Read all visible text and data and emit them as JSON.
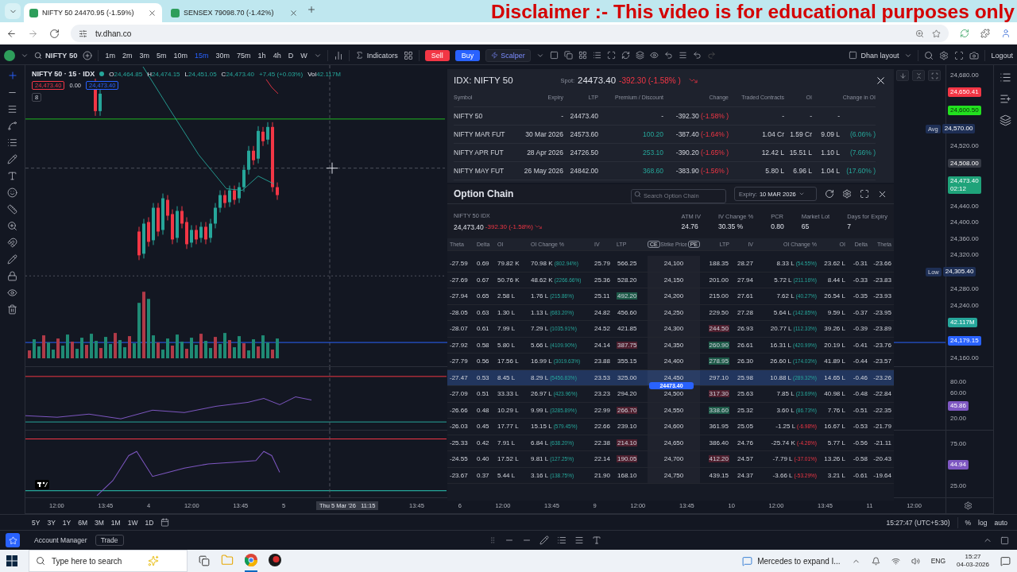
{
  "overlay_caption": "Disclaimer :- This video is for educational purposes only",
  "browser": {
    "tabs": [
      {
        "title": "NIFTY 50 24470.95 (-1.59%)",
        "selected": true
      },
      {
        "title": "SENSEX 79098.70 (-1.42%)",
        "selected": false
      }
    ],
    "url": "tv.dhan.co"
  },
  "toolbar": {
    "symbol": "NIFTY 50",
    "timeframes": [
      {
        "label": "1m",
        "selected": false
      },
      {
        "label": "2m",
        "selected": false
      },
      {
        "label": "3m",
        "selected": false
      },
      {
        "label": "5m",
        "selected": false
      },
      {
        "label": "10m",
        "selected": false
      },
      {
        "label": "15m",
        "selected": true
      },
      {
        "label": "30m",
        "selected": false
      },
      {
        "label": "75m",
        "selected": false
      },
      {
        "label": "1h",
        "selected": false
      },
      {
        "label": "4h",
        "selected": false
      },
      {
        "label": "D",
        "selected": false
      },
      {
        "label": "W",
        "selected": false
      }
    ],
    "indicators": "Indicators",
    "sell": "Sell",
    "buy": "Buy",
    "scalper": "Scalper",
    "layout": "Dhan layout",
    "logout": "Logout"
  },
  "chart": {
    "legend": {
      "title": "NIFTY 50 · 15 · IDX",
      "ohlc": [
        {
          "label": "O",
          "value": "24,464.85"
        },
        {
          "label": "H",
          "value": "24,474.15"
        },
        {
          "label": "L",
          "value": "24,451.05"
        },
        {
          "label": "C",
          "value": "24,473.40"
        }
      ],
      "change": "+7.45 (+0.03%)",
      "volume_label": "Vol",
      "volume": "42.117M"
    },
    "price_tags": [
      "24,473.40",
      "0.00",
      "24,473.40"
    ],
    "count": "8",
    "price_axis": [
      {
        "kind": "tick",
        "text": "24,680.00"
      },
      {
        "kind": "badge",
        "text": "24,650.41",
        "color": "#f23645"
      },
      {
        "kind": "badge",
        "text": "24,600.50",
        "color": "#22e01f"
      },
      {
        "kind": "badge",
        "text": "24,570.00",
        "color": "#1e2f55",
        "tag": "Avg"
      },
      {
        "kind": "tick",
        "text": "24,520.00"
      },
      {
        "kind": "badge",
        "text": "24,508.00",
        "color": "#363a45"
      },
      {
        "kind": "badge",
        "text": "24,473.40",
        "color": "#1fa37a",
        "sub": "02:12"
      },
      {
        "kind": "tick",
        "text": "24,440.00"
      },
      {
        "kind": "tick",
        "text": "24,400.00"
      },
      {
        "kind": "tick",
        "text": "24,360.00"
      },
      {
        "kind": "tick",
        "text": "24,320.00"
      },
      {
        "kind": "badge",
        "text": "24,305.40",
        "color": "#1e2f55",
        "tag": "Low"
      },
      {
        "kind": "tick",
        "text": "24,280.00"
      },
      {
        "kind": "tick",
        "text": "24,240.00"
      },
      {
        "kind": "badge",
        "text": "42.117M",
        "color": "#26a69a"
      },
      {
        "kind": "badge",
        "text": "24,179.15",
        "color": "#2962ff"
      },
      {
        "kind": "tick",
        "text": "24,160.00"
      }
    ],
    "pane2_axis": [
      {
        "kind": "tick",
        "text": "80.00"
      },
      {
        "kind": "tick",
        "text": "60.00"
      },
      {
        "kind": "badge",
        "text": "45.86",
        "color": "#7e57c2"
      },
      {
        "kind": "tick",
        "text": "20.00"
      }
    ],
    "pane3_axis": [
      {
        "kind": "tick",
        "text": "75.00"
      },
      {
        "kind": "badge",
        "text": "44.94",
        "color": "#7e57c2"
      },
      {
        "kind": "tick",
        "text": "25.00"
      }
    ],
    "time_axis": [
      {
        "kind": "tick",
        "text": "12:00"
      },
      {
        "kind": "tick",
        "text": "13:45"
      },
      {
        "kind": "tick",
        "text": "4"
      },
      {
        "kind": "tick",
        "text": "12:00"
      },
      {
        "kind": "tick",
        "text": "13:45"
      },
      {
        "kind": "tick",
        "text": "5"
      },
      {
        "kind": "cursor",
        "text": "Thu 5 Mar '26   11:15"
      },
      {
        "kind": "tick",
        "text": "13:45"
      },
      {
        "kind": "tick",
        "text": "6"
      },
      {
        "kind": "tick",
        "text": "12:00"
      },
      {
        "kind": "tick",
        "text": "13:45"
      },
      {
        "kind": "tick",
        "text": "9"
      },
      {
        "kind": "tick",
        "text": "12:00"
      },
      {
        "kind": "tick",
        "text": "13:45"
      },
      {
        "kind": "tick",
        "text": "10"
      },
      {
        "kind": "tick",
        "text": "12:00"
      },
      {
        "kind": "tick",
        "text": "13:45"
      },
      {
        "kind": "tick",
        "text": "11"
      },
      {
        "kind": "tick",
        "text": "12:00"
      }
    ]
  },
  "futures_panel": {
    "title": "IDX: NIFTY 50",
    "spot_label": "Spot:",
    "spot": "24473.40",
    "spot_change": "-392.30 (-1.58% )",
    "columns": [
      "Symbol",
      "Expiry",
      "LTP",
      "Premium / Discount",
      "Change",
      "Traded Contracts",
      "OI",
      "Change in OI"
    ],
    "rows": [
      {
        "symbol": "NIFTY 50",
        "expiry": "-",
        "ltp": "24473.40",
        "premium": "-",
        "change": "-392.30",
        "change_pct": "(-1.58% )",
        "traded": "-",
        "oi": "-",
        "oi_change": "-"
      },
      {
        "symbol": "NIFTY MAR FUT",
        "expiry": "30 Mar 2026",
        "ltp": "24573.60",
        "premium": "100.20",
        "change": "-387.40",
        "change_pct": "(-1.64% )",
        "traded": "1.04 Cr",
        "oi": "1.59 Cr",
        "oi_change": "9.09 L",
        "oi_change_pct": "(6.06% )"
      },
      {
        "symbol": "NIFTY APR FUT",
        "expiry": "28 Apr 2026",
        "ltp": "24726.50",
        "premium": "253.10",
        "change": "-390.20",
        "change_pct": "(-1.65% )",
        "traded": "12.42 L",
        "oi": "15.51 L",
        "oi_change": "1.10 L",
        "oi_change_pct": "(7.66% )"
      },
      {
        "symbol": "NIFTY MAY FUT",
        "expiry": "26 May 2026",
        "ltp": "24842.00",
        "premium": "368.60",
        "change": "-383.90",
        "change_pct": "(-1.56% )",
        "traded": "5.80 L",
        "oi": "6.96 L",
        "oi_change": "1.04 L",
        "oi_change_pct": "(17.60% )"
      }
    ]
  },
  "option_chain": {
    "title": "Option Chain",
    "search_placeholder": "Search Option Chain",
    "expiry_label": "Expiry:",
    "expiry": "10 MAR 2026",
    "underlying": "NIFTY 50",
    "underlying_tag": "IDX",
    "underlying_price": "24,473.40",
    "underlying_change": "-392.30 (-1.58%)",
    "stats": [
      {
        "label": "ATM IV",
        "value": "24.76"
      },
      {
        "label": "IV Change %",
        "value": "30.35 %"
      },
      {
        "label": "PCR",
        "value": "0.80"
      },
      {
        "label": "Market Lot",
        "value": "65"
      },
      {
        "label": "Days for Expiry",
        "value": "7"
      }
    ],
    "call_columns": [
      "Theta",
      "Delta",
      "OI",
      "OI Change %",
      "IV",
      "LTP"
    ],
    "call_badge": "CE",
    "strike_column": "Strike Price",
    "put_badge": "PE",
    "put_columns": [
      "LTP",
      "IV",
      "OI Change %",
      "OI",
      "Delta",
      "Theta"
    ],
    "spot_marker": "24473.40",
    "rows": [
      {
        "strike": "24,100",
        "selected": false,
        "ce": {
          "theta": "-27.59",
          "delta": "0.69",
          "oi": "79.82 K",
          "oi_chg": "70.98 K",
          "oi_chg_pct": "(802.94%)",
          "oi_chg_negative": false,
          "iv": "25.79",
          "ltp": "566.25",
          "ltp_flash_up": false,
          "ltp_flash_down": false
        },
        "pe": {
          "ltp": "188.35",
          "ltp_flash_up": false,
          "ltp_flash_down": false,
          "iv": "28.27",
          "oi_chg": "8.33 L",
          "oi_chg_pct": "(54.55%)",
          "oi_chg_negative": false,
          "oi": "23.62 L",
          "delta": "-0.31",
          "theta": "-23.66"
        }
      },
      {
        "strike": "24,150",
        "selected": false,
        "ce": {
          "theta": "-27.69",
          "delta": "0.67",
          "oi": "50.76 K",
          "oi_chg": "48.62 K",
          "oi_chg_pct": "(2266.66%)",
          "oi_chg_negative": false,
          "iv": "25.36",
          "ltp": "528.20",
          "ltp_flash_up": false,
          "ltp_flash_down": false
        },
        "pe": {
          "ltp": "201.00",
          "ltp_flash_up": false,
          "ltp_flash_down": false,
          "iv": "27.94",
          "oi_chg": "5.72 L",
          "oi_chg_pct": "(211.16%)",
          "oi_chg_negative": false,
          "oi": "8.44 L",
          "delta": "-0.33",
          "theta": "-23.83"
        }
      },
      {
        "strike": "24,200",
        "selected": false,
        "ce": {
          "theta": "-27.94",
          "delta": "0.65",
          "oi": "2.58 L",
          "oi_chg": "1.76 L",
          "oi_chg_pct": "(215.86%)",
          "oi_chg_negative": false,
          "iv": "25.11",
          "ltp": "492.20",
          "ltp_flash_up": true,
          "ltp_flash_down": false
        },
        "pe": {
          "ltp": "215.00",
          "ltp_flash_up": false,
          "ltp_flash_down": false,
          "iv": "27.61",
          "oi_chg": "7.62 L",
          "oi_chg_pct": "(40.27%)",
          "oi_chg_negative": false,
          "oi": "26.54 L",
          "delta": "-0.35",
          "theta": "-23.93"
        }
      },
      {
        "strike": "24,250",
        "selected": false,
        "ce": {
          "theta": "-28.05",
          "delta": "0.63",
          "oi": "1.30 L",
          "oi_chg": "1.13 L",
          "oi_chg_pct": "(683.20%)",
          "oi_chg_negative": false,
          "iv": "24.82",
          "ltp": "456.60",
          "ltp_flash_up": false,
          "ltp_flash_down": false
        },
        "pe": {
          "ltp": "229.50",
          "ltp_flash_up": false,
          "ltp_flash_down": false,
          "iv": "27.28",
          "oi_chg": "5.64 L",
          "oi_chg_pct": "(142.85%)",
          "oi_chg_negative": false,
          "oi": "9.59 L",
          "delta": "-0.37",
          "theta": "-23.95"
        }
      },
      {
        "strike": "24,300",
        "selected": false,
        "ce": {
          "theta": "-28.07",
          "delta": "0.61",
          "oi": "7.99 L",
          "oi_chg": "7.29 L",
          "oi_chg_pct": "(1035.91%)",
          "oi_chg_negative": false,
          "iv": "24.52",
          "ltp": "421.85",
          "ltp_flash_up": false,
          "ltp_flash_down": false
        },
        "pe": {
          "ltp": "244.50",
          "ltp_flash_up": false,
          "ltp_flash_down": true,
          "iv": "26.93",
          "oi_chg": "20.77 L",
          "oi_chg_pct": "(112.33%)",
          "oi_chg_negative": false,
          "oi": "39.26 L",
          "delta": "-0.39",
          "theta": "-23.89"
        }
      },
      {
        "strike": "24,350",
        "selected": false,
        "ce": {
          "theta": "-27.92",
          "delta": "0.58",
          "oi": "5.80 L",
          "oi_chg": "5.66 L",
          "oi_chg_pct": "(4109.90%)",
          "oi_chg_negative": false,
          "iv": "24.14",
          "ltp": "387.75",
          "ltp_flash_up": false,
          "ltp_flash_down": true
        },
        "pe": {
          "ltp": "260.90",
          "ltp_flash_up": true,
          "ltp_flash_down": false,
          "iv": "26.61",
          "oi_chg": "16.31 L",
          "oi_chg_pct": "(420.99%)",
          "oi_chg_negative": false,
          "oi": "20.19 L",
          "delta": "-0.41",
          "theta": "-23.76"
        }
      },
      {
        "strike": "24,400",
        "selected": false,
        "ce": {
          "theta": "-27.79",
          "delta": "0.56",
          "oi": "17.56 L",
          "oi_chg": "16.99 L",
          "oi_chg_pct": "(3019.63%)",
          "oi_chg_negative": false,
          "iv": "23.88",
          "ltp": "355.15",
          "ltp_flash_up": false,
          "ltp_flash_down": false
        },
        "pe": {
          "ltp": "278.95",
          "ltp_flash_up": true,
          "ltp_flash_down": false,
          "iv": "26.30",
          "oi_chg": "26.60 L",
          "oi_chg_pct": "(174.03%)",
          "oi_chg_negative": false,
          "oi": "41.89 L",
          "delta": "-0.44",
          "theta": "-23.57"
        }
      },
      {
        "strike": "24,450",
        "selected": true,
        "ce": {
          "theta": "-27.47",
          "delta": "0.53",
          "oi": "8.45 L",
          "oi_chg": "8.29 L",
          "oi_chg_pct": "(5456.83%)",
          "oi_chg_negative": false,
          "iv": "23.53",
          "ltp": "325.00",
          "ltp_flash_up": false,
          "ltp_flash_down": false
        },
        "pe": {
          "ltp": "297.10",
          "ltp_flash_up": false,
          "ltp_flash_down": false,
          "iv": "25.98",
          "oi_chg": "10.88 L",
          "oi_chg_pct": "(289.32%)",
          "oi_chg_negative": false,
          "oi": "14.65 L",
          "delta": "-0.46",
          "theta": "-23.26"
        }
      },
      {
        "strike": "24,500",
        "selected": false,
        "ce": {
          "theta": "-27.09",
          "delta": "0.51",
          "oi": "33.33 L",
          "oi_chg": "26.97 L",
          "oi_chg_pct": "(423.96%)",
          "oi_chg_negative": false,
          "iv": "23.23",
          "ltp": "294.20",
          "ltp_flash_up": false,
          "ltp_flash_down": false
        },
        "pe": {
          "ltp": "317.30",
          "ltp_flash_up": false,
          "ltp_flash_down": true,
          "iv": "25.63",
          "oi_chg": "7.85 L",
          "oi_chg_pct": "(23.69%)",
          "oi_chg_negative": false,
          "oi": "40.98 L",
          "delta": "-0.48",
          "theta": "-22.84"
        }
      },
      {
        "strike": "24,550",
        "selected": false,
        "ce": {
          "theta": "-26.66",
          "delta": "0.48",
          "oi": "10.29 L",
          "oi_chg": "9.99 L",
          "oi_chg_pct": "(3285.89%)",
          "oi_chg_negative": false,
          "iv": "22.99",
          "ltp": "266.70",
          "ltp_flash_up": false,
          "ltp_flash_down": true
        },
        "pe": {
          "ltp": "338.60",
          "ltp_flash_up": true,
          "ltp_flash_down": false,
          "iv": "25.32",
          "oi_chg": "3.60 L",
          "oi_chg_pct": "(86.73%)",
          "oi_chg_negative": false,
          "oi": "7.76 L",
          "delta": "-0.51",
          "theta": "-22.35"
        }
      },
      {
        "strike": "24,600",
        "selected": false,
        "ce": {
          "theta": "-26.03",
          "delta": "0.45",
          "oi": "17.77 L",
          "oi_chg": "15.15 L",
          "oi_chg_pct": "(579.45%)",
          "oi_chg_negative": false,
          "iv": "22.66",
          "ltp": "239.10",
          "ltp_flash_up": false,
          "ltp_flash_down": false
        },
        "pe": {
          "ltp": "361.95",
          "ltp_flash_up": false,
          "ltp_flash_down": false,
          "iv": "25.05",
          "oi_chg": "-1.25 L",
          "oi_chg_pct": "(-6.98%)",
          "oi_chg_negative": true,
          "oi": "16.67 L",
          "delta": "-0.53",
          "theta": "-21.79"
        }
      },
      {
        "strike": "24,650",
        "selected": false,
        "ce": {
          "theta": "-25.33",
          "delta": "0.42",
          "oi": "7.91 L",
          "oi_chg": "6.84 L",
          "oi_chg_pct": "(638.20%)",
          "oi_chg_negative": false,
          "iv": "22.38",
          "ltp": "214.10",
          "ltp_flash_up": false,
          "ltp_flash_down": true
        },
        "pe": {
          "ltp": "386.40",
          "ltp_flash_up": false,
          "ltp_flash_down": false,
          "iv": "24.76",
          "oi_chg": "-25.74 K",
          "oi_chg_pct": "(-4.26%)",
          "oi_chg_negative": true,
          "oi": "5.77 L",
          "delta": "-0.56",
          "theta": "-21.11"
        }
      },
      {
        "strike": "24,700",
        "selected": false,
        "ce": {
          "theta": "-24.55",
          "delta": "0.40",
          "oi": "17.52 L",
          "oi_chg": "9.81 L",
          "oi_chg_pct": "(127.25%)",
          "oi_chg_negative": false,
          "iv": "22.14",
          "ltp": "190.05",
          "ltp_flash_up": false,
          "ltp_flash_down": true
        },
        "pe": {
          "ltp": "412.20",
          "ltp_flash_up": false,
          "ltp_flash_down": true,
          "iv": "24.57",
          "oi_chg": "-7.79 L",
          "oi_chg_pct": "(-37.01%)",
          "oi_chg_negative": true,
          "oi": "13.26 L",
          "delta": "-0.58",
          "theta": "-20.43"
        }
      },
      {
        "strike": "24,750",
        "selected": false,
        "ce": {
          "theta": "-23.67",
          "delta": "0.37",
          "oi": "5.44 L",
          "oi_chg": "3.16 L",
          "oi_chg_pct": "(138.75%)",
          "oi_chg_negative": false,
          "iv": "21.90",
          "ltp": "168.10",
          "ltp_flash_up": false,
          "ltp_flash_down": false
        },
        "pe": {
          "ltp": "439.15",
          "ltp_flash_up": false,
          "ltp_flash_down": false,
          "iv": "24.37",
          "oi_chg": "-3.66 L",
          "oi_chg_pct": "(-53.29%)",
          "oi_chg_negative": true,
          "oi": "3.21 L",
          "delta": "-0.61",
          "theta": "-19.64"
        }
      }
    ]
  },
  "bottom_bar": {
    "ranges": [
      "5Y",
      "3Y",
      "1Y",
      "6M",
      "3M",
      "1M",
      "1W",
      "1D"
    ],
    "clock": "15:27:47 (UTC+5:30)",
    "scale_options": [
      "%",
      "log",
      "auto"
    ]
  },
  "account_bar": {
    "label": "Account Manager",
    "trade": "Trade"
  },
  "taskbar": {
    "search_placeholder": "Type here to search",
    "notification": "Mercedes to expand I...",
    "language": "ENG",
    "time": "15:27",
    "date": "04-03-2026"
  }
}
